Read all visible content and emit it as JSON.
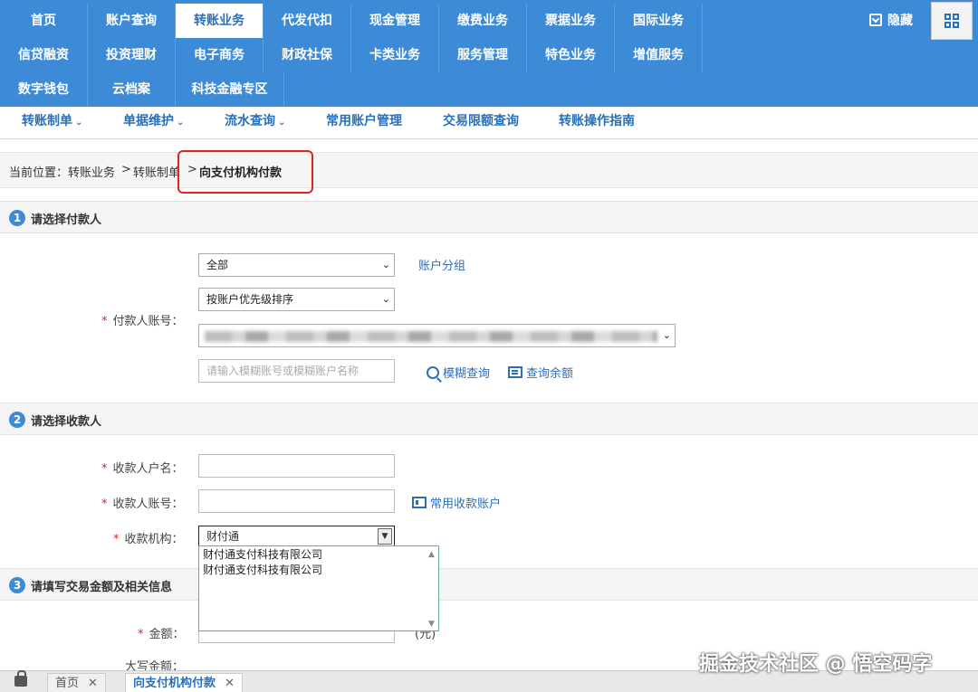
{
  "nav": {
    "row1": [
      "首页",
      "账户查询",
      "转账业务",
      "代发代扣",
      "现金管理",
      "缴费业务",
      "票据业务",
      "国际业务"
    ],
    "row2": [
      "信贷融资",
      "投资理财",
      "电子商务",
      "财政社保",
      "卡类业务",
      "服务管理",
      "特色业务",
      "增值服务"
    ],
    "row3": [
      "数字钱包",
      "云档案",
      "科技金融专区"
    ],
    "active": "转账业务",
    "hide_label": "隐藏"
  },
  "subnav": {
    "items": [
      "转账制单",
      "单据维护",
      "流水查询",
      "常用账户管理",
      "交易限额查询",
      "转账操作指南"
    ]
  },
  "breadcrumb": {
    "prefix": "当前位置：",
    "items": [
      "转账业务",
      "转账制单"
    ],
    "current": "向支付机构付款"
  },
  "section1": {
    "num": "1",
    "title": "请选择付款人",
    "group_select": "全部",
    "group_link": "账户分组",
    "sort_select": "按账户优先级排序",
    "payer_label": "付款人账号：",
    "search_placeholder": "请输入模糊账号或模糊账户名称",
    "fuzzy_search": "模糊查询",
    "query_balance": "查询余额"
  },
  "section2": {
    "num": "2",
    "title": "请选择收款人",
    "name_label": "收款人户名：",
    "account_label": "收款人账号：",
    "common_accounts": "常用收款账户",
    "org_label": "收款机构：",
    "org_value": "财付通",
    "options": [
      "财付通支付科技有限公司",
      "财付通支付科技有限公司"
    ]
  },
  "section3": {
    "num": "3",
    "title": "请填写交易金额及相关信息",
    "amount_label": "金额：",
    "amount_unit": "(元)",
    "upper_amount_label": "大写金额："
  },
  "bottom_tabs": {
    "home": "首页",
    "current": "向支付机构付款"
  },
  "watermark": "掘金技术社区 @ 悟空码字",
  "colors": {
    "nav_bg": "#3d8bd6",
    "link": "#2a6fba",
    "highlight": "#e02424"
  }
}
